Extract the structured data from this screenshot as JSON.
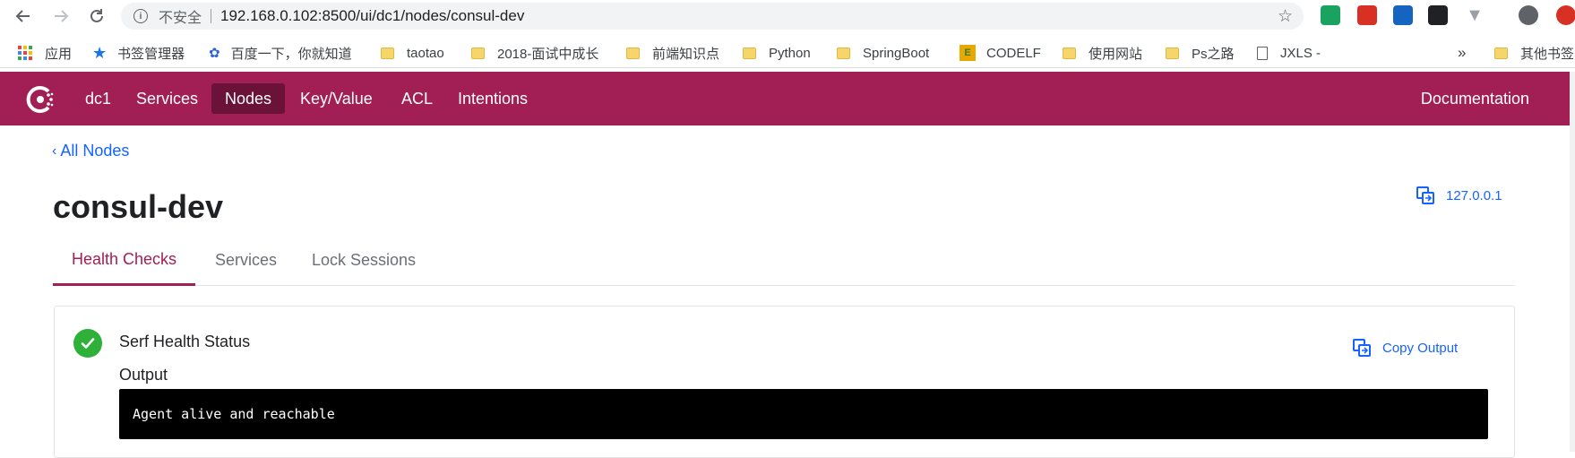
{
  "browser": {
    "insecure_label": "不安全",
    "url": "192.168.0.102:8500/ui/dc1/nodes/consul-dev",
    "bookmarks": [
      {
        "label": "应用",
        "icon": "apps-grid-icon"
      },
      {
        "label": "书签管理器",
        "icon": "star-icon"
      },
      {
        "label": "百度一下，你就知道",
        "icon": "baidu-paw-icon"
      },
      {
        "label": "taotao",
        "icon": "folder-icon"
      },
      {
        "label": "2018-面试中成长",
        "icon": "folder-icon"
      },
      {
        "label": "前端知识点",
        "icon": "folder-icon"
      },
      {
        "label": "Python",
        "icon": "folder-icon"
      },
      {
        "label": "SpringBoot",
        "icon": "folder-icon"
      },
      {
        "label": "CODELF",
        "icon": "codelf-icon"
      },
      {
        "label": "使用网站",
        "icon": "folder-icon"
      },
      {
        "label": "Ps之路",
        "icon": "folder-icon"
      },
      {
        "label": "JXLS -",
        "icon": "document-icon"
      },
      {
        "label": "»",
        "icon": ""
      },
      {
        "label": "其他书签",
        "icon": "folder-icon"
      }
    ]
  },
  "nav": {
    "datacenter": "dc1",
    "items": [
      "Services",
      "Nodes",
      "Key/Value",
      "ACL",
      "Intentions"
    ],
    "active": "Nodes",
    "documentation": "Documentation",
    "brand_color": "#a11f55"
  },
  "page": {
    "back_label": "All Nodes",
    "title": "consul-dev",
    "address": "127.0.0.1",
    "tabs": [
      "Health Checks",
      "Services",
      "Lock Sessions"
    ],
    "active_tab": "Health Checks"
  },
  "check": {
    "name": "Serf Health Status",
    "status": "passing",
    "output_label": "Output",
    "copy_label": "Copy Output",
    "output": "Agent alive and reachable"
  }
}
